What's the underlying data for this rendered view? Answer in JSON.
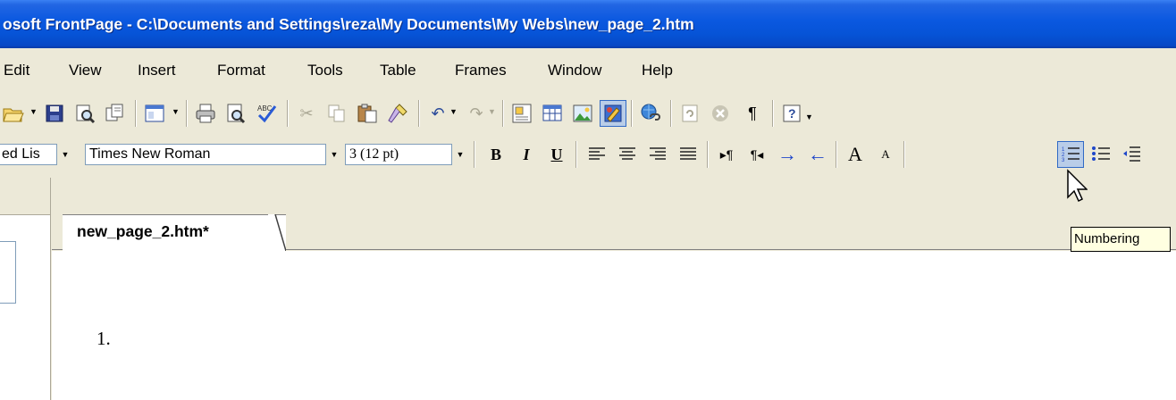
{
  "window": {
    "title": "osoft FrontPage - C:\\Documents and Settings\\reza\\My Documents\\My Webs\\new_page_2.htm"
  },
  "menubar": {
    "items": [
      "Edit",
      "View",
      "Insert",
      "Format",
      "Tools",
      "Table",
      "Frames",
      "Window",
      "Help"
    ]
  },
  "formatting": {
    "style_value": "ed Lis",
    "font_value": "Times New Roman",
    "size_value": "3  (12 pt)",
    "bold": "B",
    "italic": "I",
    "underline": "U",
    "grow_font": "A",
    "shrink_font": "A"
  },
  "standard": {
    "show_all": "¶"
  },
  "editor": {
    "tab_label": "new_page_2.htm*",
    "list_marker": "1."
  },
  "tooltip": {
    "text": "Numbering"
  },
  "colors": {
    "titlebar": "#0653d6",
    "toolbar_bg": "#ece9d8",
    "tooltip_bg": "#ffffe1",
    "pressed_button": "#b9cde8"
  }
}
